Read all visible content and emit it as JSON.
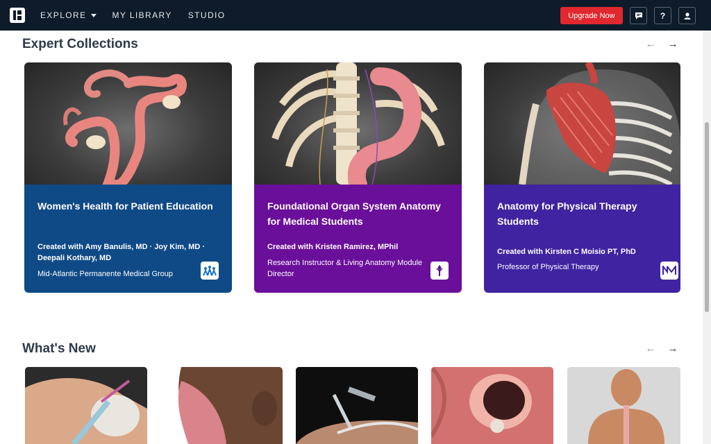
{
  "nav": {
    "explore": "EXPLORE",
    "library": "MY LIBRARY",
    "studio": "STUDIO",
    "upgrade": "Upgrade Now",
    "help": "?",
    "icons": [
      "chat-icon",
      "help-icon",
      "user-icon"
    ]
  },
  "expert": {
    "title": "Expert Collections",
    "prev": "←",
    "next": "→",
    "cards": [
      {
        "title": "Women's Health for Patient Education",
        "creator": "Created with Amy Banulis, MD · Joy Kim, MD · Deepali Kothary, MD",
        "role": "Mid-Atlantic Permanente Medical Group",
        "color": "#0f4a86"
      },
      {
        "title": "Foundational Organ System Anatomy for Medical Students",
        "creator": "Created with Kristen Ramirez, MPhil",
        "role": "Research Instructor & Living Anatomy Module Director",
        "color": "#6a0f9a"
      },
      {
        "title": "Anatomy for Physical Therapy Students",
        "creator": "Created with Kirsten C Moisio PT, PhD",
        "role": "Professor of Physical Therapy",
        "color": "#3f23a0"
      }
    ]
  },
  "whatsnew": {
    "title": "What's New",
    "prev": "←",
    "next": "→"
  },
  "colors": {
    "nav_bg": "#0d1b2a",
    "upgrade": "#e0282e",
    "heading": "#2d3a4b"
  }
}
